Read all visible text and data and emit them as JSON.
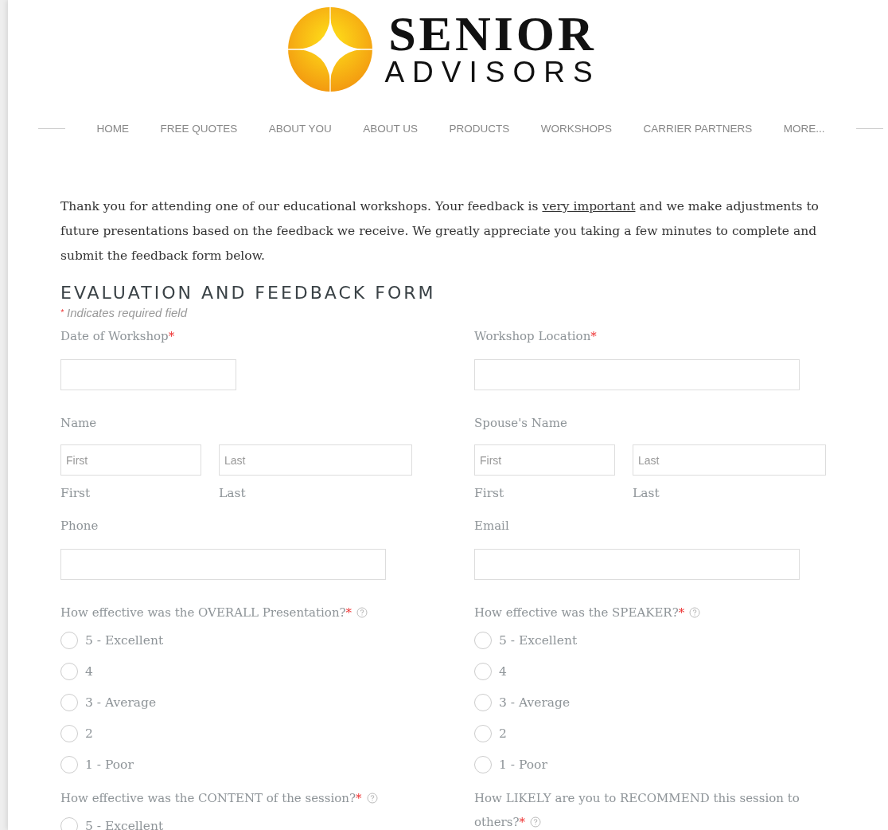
{
  "logo": {
    "line1": "SENIOR",
    "line2": "ADVISORS"
  },
  "nav": [
    "HOME",
    "FREE QUOTES",
    "ABOUT YOU",
    "ABOUT US",
    "PRODUCTS",
    "WORKSHOPS",
    "CARRIER PARTNERS",
    "MORE..."
  ],
  "intro": {
    "before": "Thank you for attending one of our educational workshops.  Your feedback is ",
    "link": "very important",
    "after": " and we make adjustments to future presentations based on the feedback we receive.  We greatly appreciate you taking a few minutes to complete and submit the feedback form below."
  },
  "form": {
    "title": "EVALUATION AND FEEDBACK FORM",
    "required_note": {
      "mark": "*",
      "text": "Indicates required field"
    },
    "rows": [
      [
        {
          "kind": "date",
          "label": "Date of Workshop",
          "required": true
        },
        {
          "kind": "text",
          "label": "Workshop Location",
          "required": true
        }
      ],
      [
        {
          "kind": "name",
          "label": "Name",
          "required": false,
          "parts": [
            {
              "placeholder": "First",
              "caption": "First"
            },
            {
              "placeholder": "Last",
              "caption": "Last"
            }
          ]
        },
        {
          "kind": "name",
          "label": "Spouse's Name",
          "required": false,
          "parts": [
            {
              "placeholder": "First",
              "caption": "First"
            },
            {
              "placeholder": "Last",
              "caption": "Last"
            }
          ]
        }
      ],
      [
        {
          "kind": "text",
          "label": "Phone",
          "required": false
        },
        {
          "kind": "text",
          "label": "Email",
          "required": false
        }
      ],
      [
        {
          "kind": "radio",
          "label": "How effective was the OVERALL Presentation?",
          "required": true,
          "help": true,
          "options": [
            {
              "label": "5 - Excellent",
              "selected": false
            },
            {
              "label": "4",
              "selected": false
            },
            {
              "label": "3 - Average",
              "selected": false
            },
            {
              "label": "2",
              "selected": false
            },
            {
              "label": "1 - Poor",
              "selected": false
            }
          ]
        },
        {
          "kind": "radio",
          "label": "How effective was the SPEAKER?",
          "required": true,
          "help": true,
          "options": [
            {
              "label": "5 - Excellent",
              "selected": false
            },
            {
              "label": "4",
              "selected": false
            },
            {
              "label": "3 - Average",
              "selected": false
            },
            {
              "label": "2",
              "selected": false
            },
            {
              "label": "1 - Poor",
              "selected": false
            }
          ]
        }
      ],
      [
        {
          "kind": "radio",
          "label": "How effective was the CONTENT of the session?",
          "required": true,
          "help": true,
          "options": [
            {
              "label": "5 - Excellent",
              "selected": false
            }
          ]
        },
        {
          "kind": "radio",
          "label": "How LIKELY are you to RECOMMEND this session to others?",
          "required": true,
          "help": true
        }
      ]
    ]
  }
}
